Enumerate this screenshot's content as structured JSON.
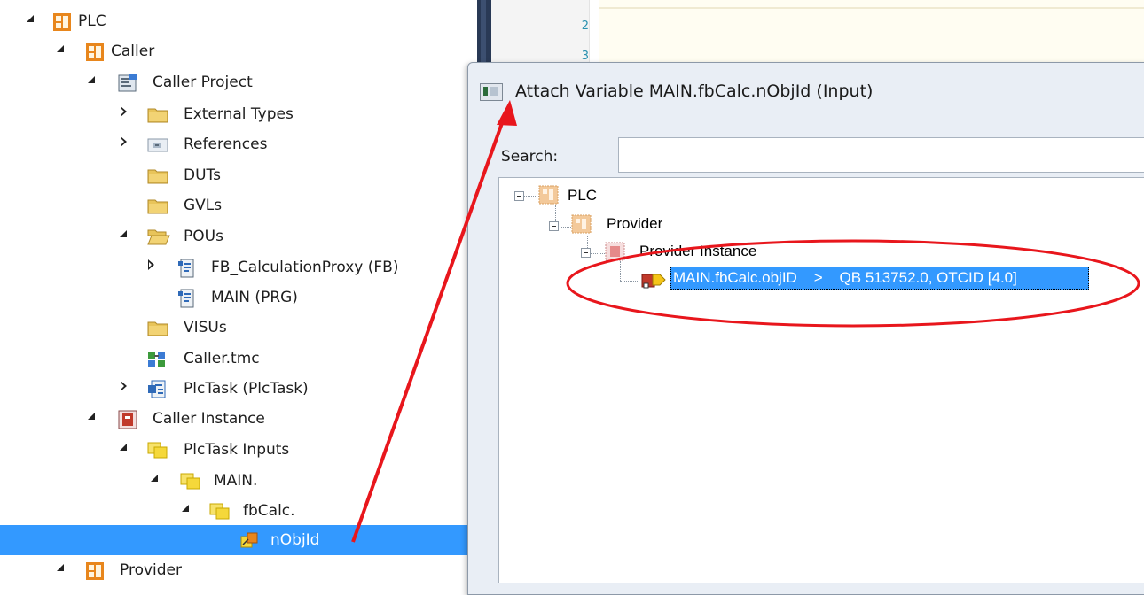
{
  "tree": {
    "items": [
      {
        "label": "PLC"
      },
      {
        "label": "Caller"
      },
      {
        "label": "Caller Project"
      },
      {
        "label": "External Types"
      },
      {
        "label": "References"
      },
      {
        "label": "DUTs"
      },
      {
        "label": "GVLs"
      },
      {
        "label": "POUs"
      },
      {
        "label": "FB_CalculationProxy (FB)"
      },
      {
        "label": "MAIN (PRG)"
      },
      {
        "label": "VISUs"
      },
      {
        "label": "Caller.tmc"
      },
      {
        "label": "PlcTask (PlcTask)"
      },
      {
        "label": "Caller Instance"
      },
      {
        "label": "PlcTask Inputs"
      },
      {
        "label": "MAIN."
      },
      {
        "label": "fbCalc."
      },
      {
        "label": "nObjId"
      },
      {
        "label": "Provider"
      }
    ]
  },
  "editor": {
    "line_numbers": [
      "2",
      "3"
    ]
  },
  "dialog": {
    "title": "Attach Variable MAIN.fbCalc.nObjId (Input)",
    "search_label": "Search:",
    "search_value": "",
    "tree": {
      "plc": "PLC",
      "provider": "Provider",
      "provider_instance": "Provider Instance",
      "selected_item": "MAIN.fbCalc.objID    >    QB 513752.0, OTCID [4.0]"
    }
  },
  "colors": {
    "selection": "#3399ff",
    "annotation_red": "#e8161c",
    "plc_icon_orange": "#e8861c",
    "folder_yellow": "#f2d374"
  }
}
